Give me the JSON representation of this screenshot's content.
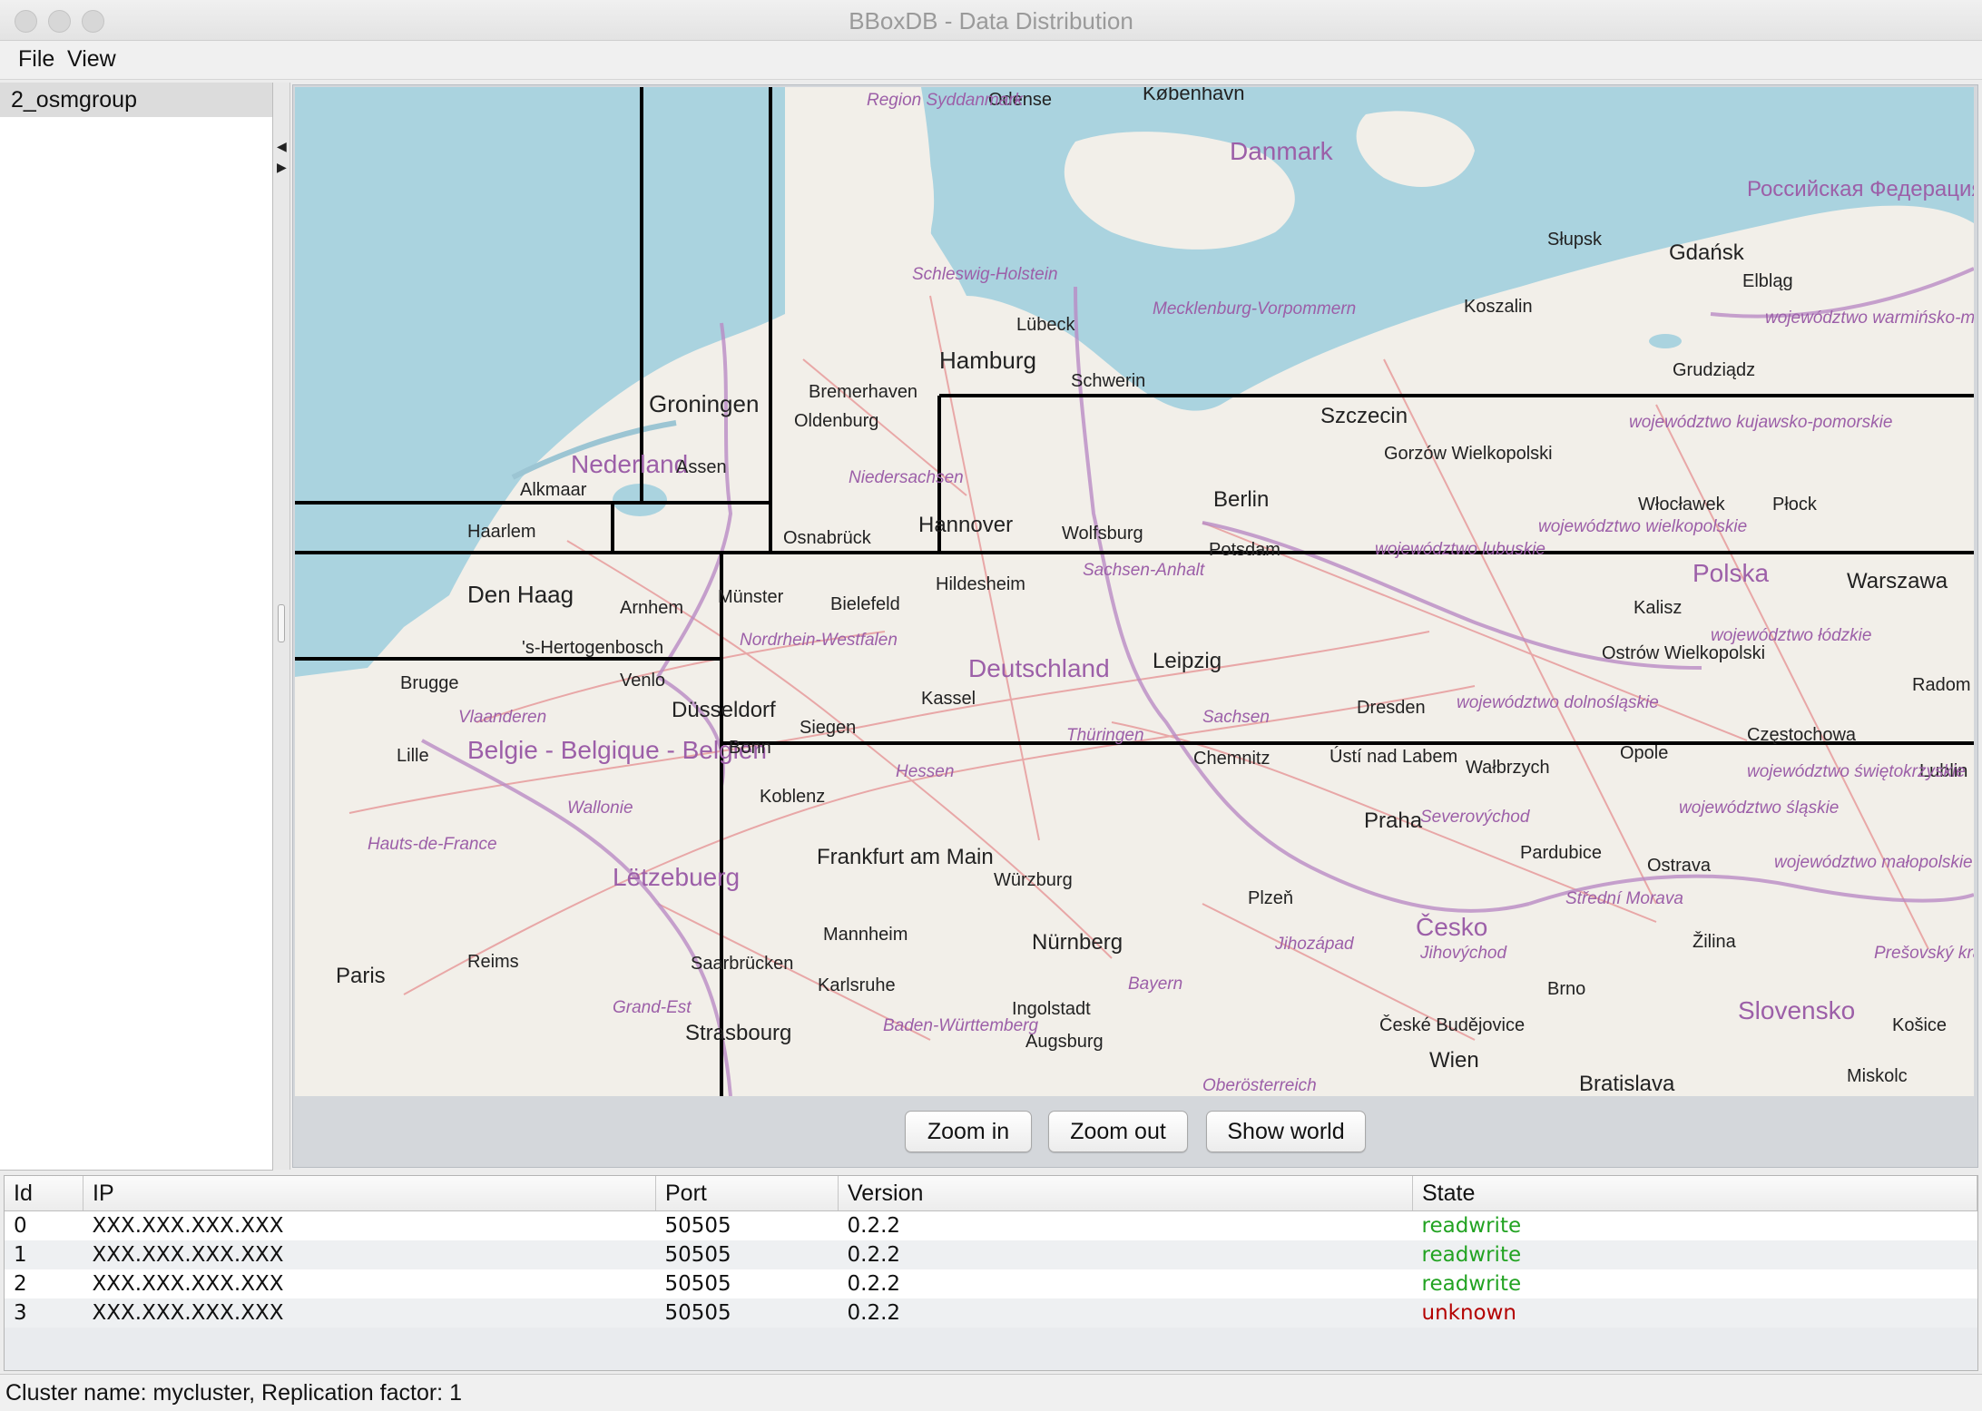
{
  "window": {
    "title": "BBoxDB - Data Distribution"
  },
  "menu": {
    "items": [
      "File",
      "View"
    ]
  },
  "sidebar": {
    "items": [
      {
        "label": "2_osmgroup",
        "selected": true
      }
    ]
  },
  "map": {
    "labels": {
      "countries": [
        "Danmark",
        "Nederland",
        "Deutschland",
        "Polska",
        "Česko",
        "Belgie - Belgique - Belgien",
        "Lëtzebuerg",
        "Slovensko",
        "Российская Федерация"
      ],
      "cities": [
        "København",
        "Odense",
        "Hamburg",
        "Bremerhaven",
        "Oldenburg",
        "Groningen",
        "Assen",
        "Alkmaar",
        "Haarlem",
        "Den Haag",
        "Arnhem",
        "Münster",
        "Osnabrück",
        "Bielefeld",
        "Hannover",
        "Wolfsburg",
        "Hildesheim",
        "Berlin",
        "Potsdam",
        "Leipzig",
        "Dresden",
        "Kassel",
        "Düsseldorf",
        "Siegen",
        "Bonn",
        "Koblenz",
        "Frankfurt am Main",
        "Würzburg",
        "Nürnberg",
        "Mannheim",
        "Karlsruhe",
        "Strasbourg",
        "Saarbrücken",
        "Paris",
        "Reims",
        "Lille",
        "Brugge",
        "Venlo",
        "Lübeck",
        "Schwerin",
        "Szczecin",
        "Gdańsk",
        "Słupsk",
        "Koszalin",
        "Elbląg",
        "Grudziądz",
        "Włocławek",
        "Płock",
        "Warszawa",
        "Kalisz",
        "Radom",
        "Opole",
        "Wałbrzych",
        "Chemnitz",
        "Ústí nad Labem",
        "Praha",
        "Plzeň",
        "Pardubice",
        "Ostrava",
        "Žilina",
        "Wien",
        "Bratislava",
        "Košice",
        "Miskolc",
        "Ingolstadt",
        "Augsburg",
        "Brno",
        "Częstochowa",
        "'s-Hertogenbosch",
        "Gorzów Wielkopolski",
        "Ostrów Wielkopolski",
        "České Budějovice",
        "Lublin"
      ],
      "regions": [
        "Region Syddanmark",
        "Schleswig-Holstein",
        "Mecklenburg-Vorpommern",
        "Niedersachsen",
        "Nordrhein-Westfalen",
        "Sachsen-Anhalt",
        "Sachsen",
        "Thüringen",
        "Hessen",
        "Bayern",
        "Baden-Württemberg",
        "Vlaanderen",
        "Wallonie",
        "Hauts-de-France",
        "Grand-Est",
        "województwo warmińsko-mazurskie",
        "województwo kujawsko-pomorskie",
        "województwo lubuskie",
        "województwo wielkopolskie",
        "województwo łódzkie",
        "województwo dolnośląskie",
        "województwo świętokrzyskie",
        "województwo śląskie",
        "województwo małopolskie",
        "Severovýchod",
        "Jihozápad",
        "Jihovýchod",
        "Střední Morava",
        "Prešovský kraj",
        "Oberösterreich"
      ]
    },
    "buttons": {
      "zoom_in": "Zoom in",
      "zoom_out": "Zoom out",
      "show_world": "Show world"
    }
  },
  "table": {
    "headers": {
      "id": "Id",
      "ip": "IP",
      "port": "Port",
      "version": "Version",
      "state": "State"
    },
    "rows": [
      {
        "id": "0",
        "ip": "XXX.XXX.XXX.XXX",
        "port": "50505",
        "version": "0.2.2",
        "state": "readwrite"
      },
      {
        "id": "1",
        "ip": "XXX.XXX.XXX.XXX",
        "port": "50505",
        "version": "0.2.2",
        "state": "readwrite"
      },
      {
        "id": "2",
        "ip": "XXX.XXX.XXX.XXX",
        "port": "50505",
        "version": "0.2.2",
        "state": "readwrite"
      },
      {
        "id": "3",
        "ip": "XXX.XXX.XXX.XXX",
        "port": "50505",
        "version": "0.2.2",
        "state": "unknown"
      }
    ],
    "state_colors": {
      "readwrite": "#22a322",
      "unknown": "#b40000"
    }
  },
  "status": {
    "text": "Cluster name: mycluster, Replication factor: 1"
  },
  "colors": {
    "sea": "#aad3df",
    "land": "#f2efe9",
    "boundary": "#b98bc4",
    "roads": "#e8a0a0",
    "region_text": "#9c5fa8"
  }
}
